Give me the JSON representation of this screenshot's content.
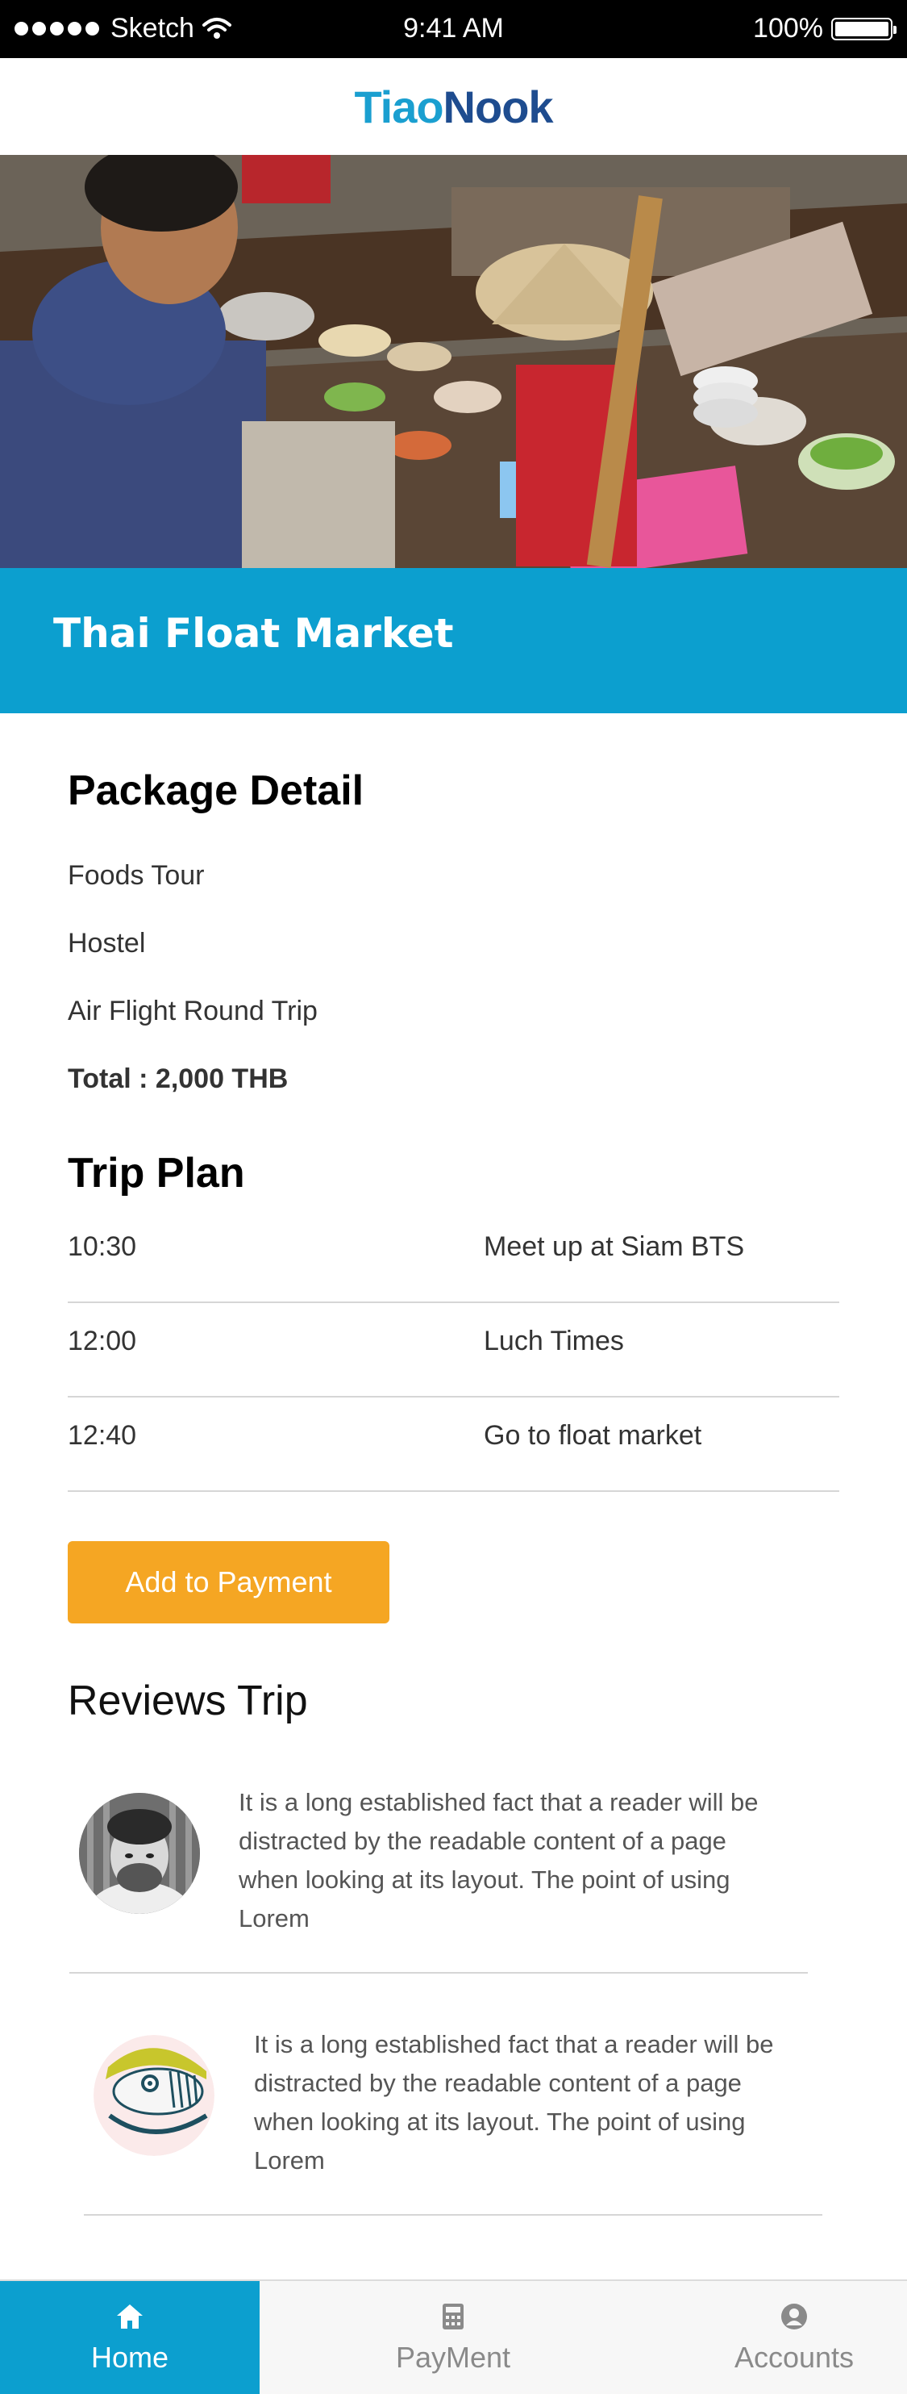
{
  "status_bar": {
    "carrier": "Sketch",
    "time": "9:41 AM",
    "battery": "100%"
  },
  "header": {
    "logo_part1": "Tiao",
    "logo_part2": "Nook",
    "brand_colors": [
      "#1a9fd0",
      "#1e4c8f"
    ]
  },
  "hero": {
    "title": "Thai Float Market",
    "band_color": "#0c9fcf"
  },
  "package": {
    "heading": "Package Detail",
    "items": [
      "Foods Tour",
      "Hostel",
      "Air Flight Round Trip"
    ],
    "total": "Total : 2,000 THB"
  },
  "trip_plan": {
    "heading": "Trip Plan",
    "rows": [
      {
        "time": "10:30",
        "activity": "Meet up at Siam BTS"
      },
      {
        "time": "12:00",
        "activity": "Luch Times"
      },
      {
        "time": "12:40",
        "activity": "Go to float market"
      }
    ]
  },
  "actions": {
    "add_to_payment": "Add to Payment",
    "button_color": "#f5a623"
  },
  "reviews": {
    "heading": "Reviews Trip",
    "items": [
      {
        "text": "It is a long established fact that a reader will be distracted by the readable content of a page when looking at its layout. The point of using Lorem"
      },
      {
        "text": "It is a long established fact that a reader will be distracted by the readable content of a page when looking at its layout. The point of using Lorem"
      }
    ]
  },
  "tabbar": {
    "tabs": [
      {
        "label": "Home",
        "icon": "home-icon",
        "active": true
      },
      {
        "label": "PayMent",
        "icon": "calculator-icon",
        "active": false
      },
      {
        "label": "Accounts",
        "icon": "account-icon",
        "active": false
      }
    ]
  }
}
